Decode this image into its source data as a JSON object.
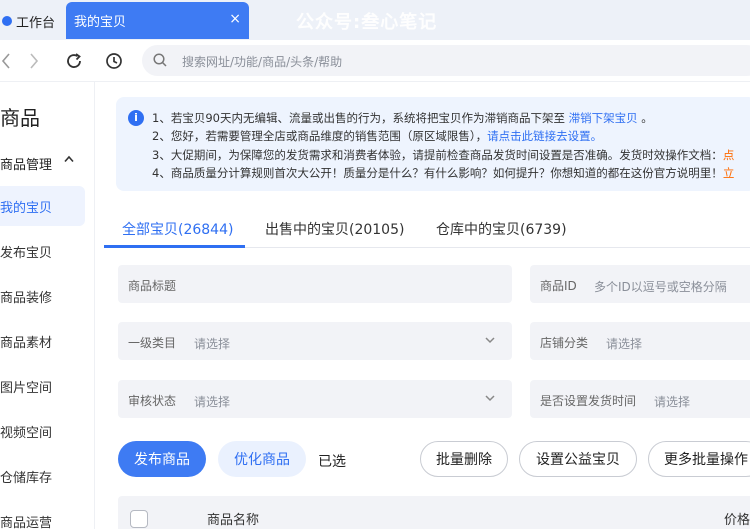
{
  "tabbar": {
    "home_label": "工作台",
    "active_tab": "我的宝贝",
    "close_glyph": "×",
    "watermark": "公众号:叁心笔记"
  },
  "navbar": {
    "back_glyph": "‹",
    "forward_glyph": "›",
    "search_placeholder": "搜索网址/功能/商品/头条/帮助"
  },
  "sidebar": {
    "title": "商品",
    "group": "商品管理",
    "group_chevron": "^",
    "items": [
      {
        "label": "我的宝贝",
        "active": true
      },
      {
        "label": "发布宝贝"
      },
      {
        "label": "商品装修"
      },
      {
        "label": "商品素材"
      },
      {
        "label": "图片空间"
      },
      {
        "label": "视频空间"
      },
      {
        "label": "仓储库存"
      },
      {
        "label": "商品运营"
      }
    ]
  },
  "notice": {
    "info_glyph": "i",
    "line1_text": "1、若宝贝90天内无编辑、流量或出售的行为，系统将把宝贝作为滞销商品下架至",
    "line1_link": "滞销下架宝贝",
    "line1_end": "。",
    "line2_text": "2、您好，若需要管理全店或商品维度的销售范围（原区域限售），",
    "line2_link": "请点击此链接去设置。",
    "line3_text": "3、大促期间，为保障您的发货需求和消费者体验，请提前检查商品发货时间设置是否准确。发货时效操作文档：",
    "line3_link": "点",
    "line4_text": "4、商品质量分计算规则首次大公开！质量分是什么？有什么影响？如何提升？你想知道的都在这份官方说明里！",
    "line4_link": "立"
  },
  "content_tabs": [
    {
      "label": "全部宝贝(26844)",
      "active": true
    },
    {
      "label": "出售中的宝贝(20105)"
    },
    {
      "label": "仓库中的宝贝(6739)"
    }
  ],
  "filters": {
    "product_title": {
      "label": "商品标题"
    },
    "product_id": {
      "label": "商品ID",
      "placeholder": "多个ID以逗号或空格分隔"
    },
    "category_l1": {
      "label": "一级类目",
      "placeholder": "请选择"
    },
    "shop_category": {
      "label": "店铺分类",
      "placeholder": "请选择"
    },
    "audit_status": {
      "label": "审核状态",
      "placeholder": "请选择"
    },
    "ship_time_set": {
      "label": "是否设置发货时间",
      "placeholder": "请选择"
    }
  },
  "actions": {
    "publish": "发布商品",
    "optimize": "优化商品",
    "selected": "已选",
    "batch_delete": "批量删除",
    "set_charity": "设置公益宝贝",
    "more_batch": "更多批量操作"
  },
  "table": {
    "col_name": "商品名称",
    "col_price": "价格"
  },
  "colors": {
    "accent": "#3e7bf3",
    "link": "#2f6ff2",
    "orange": "#ff6a00"
  }
}
